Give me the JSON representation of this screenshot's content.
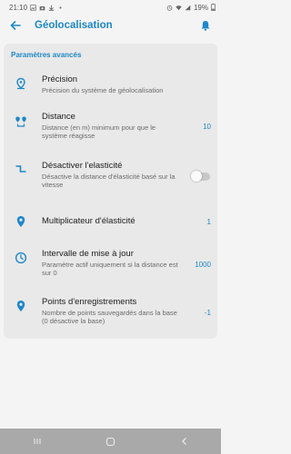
{
  "status": {
    "time": "21:10",
    "battery": "19%"
  },
  "app_bar": {
    "title": "Géolocalisation"
  },
  "section_title": "Paramètres avancés",
  "colors": {
    "accent": "#1e88c8",
    "background": "#f4f4f4",
    "card": "#e9e9e9"
  },
  "settings": [
    {
      "icon": "location-pin-icon",
      "title": "Précision",
      "subtitle": "Précision du système de géolocalisation",
      "value": ""
    },
    {
      "icon": "distance-icon",
      "title": "Distance",
      "subtitle": "Distance (en m) minimum pour que le système réagisse",
      "value": "10"
    },
    {
      "icon": "elasticity-icon",
      "title": "Désactiver l'elasticité",
      "subtitle": "Désactive la distance d'élasticité basé sur la vitesse",
      "value": ""
    },
    {
      "icon": "location-marker-icon",
      "title": "Multiplicateur d'élasticité",
      "subtitle": "",
      "value": "1"
    },
    {
      "icon": "clock-icon",
      "title": "Intervalle de mise à jour",
      "subtitle": "Paramètre actif uniquement si la distance est sur 0",
      "value": "1000"
    },
    {
      "icon": "location-marker-icon",
      "title": "Points d'enregistrements",
      "subtitle": "Nombre de points sauvegardés dans la base (0 désactive la base)",
      "value": "-1"
    }
  ],
  "toggle": {
    "state": "off"
  }
}
